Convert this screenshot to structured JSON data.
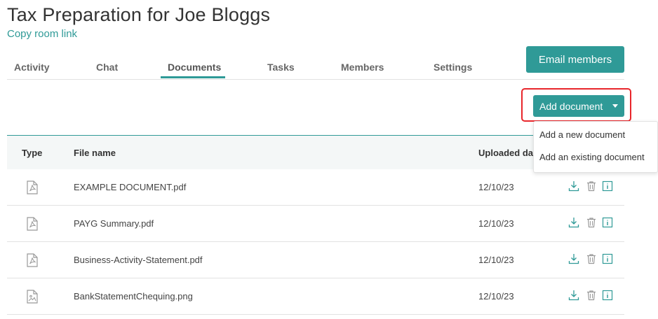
{
  "page": {
    "title": "Tax Preparation for Joe Bloggs",
    "copy_link": "Copy room link"
  },
  "tabs": [
    {
      "label": "Activity"
    },
    {
      "label": "Chat"
    },
    {
      "label": "Documents",
      "active": true
    },
    {
      "label": "Tasks"
    },
    {
      "label": "Members"
    },
    {
      "label": "Settings"
    }
  ],
  "buttons": {
    "email_members": "Email members",
    "add_document": "Add document"
  },
  "dropdown": {
    "items": [
      {
        "label": "Add a new document"
      },
      {
        "label": "Add an existing document"
      }
    ]
  },
  "table": {
    "headers": {
      "type": "Type",
      "file_name": "File name",
      "uploaded": "Uploaded da"
    },
    "rows": [
      {
        "icon": "pdf-file-icon",
        "file_name": "EXAMPLE DOCUMENT.pdf",
        "uploaded": "12/10/23"
      },
      {
        "icon": "pdf-file-icon",
        "file_name": "PAYG Summary.pdf",
        "uploaded": "12/10/23"
      },
      {
        "icon": "pdf-file-icon",
        "file_name": "Business-Activity-Statement.pdf",
        "uploaded": "12/10/23"
      },
      {
        "icon": "image-file-icon",
        "file_name": "BankStatementChequing.png",
        "uploaded": "12/10/23"
      }
    ]
  },
  "colors": {
    "accent": "#2f9a97",
    "highlight": "#e8262b"
  }
}
